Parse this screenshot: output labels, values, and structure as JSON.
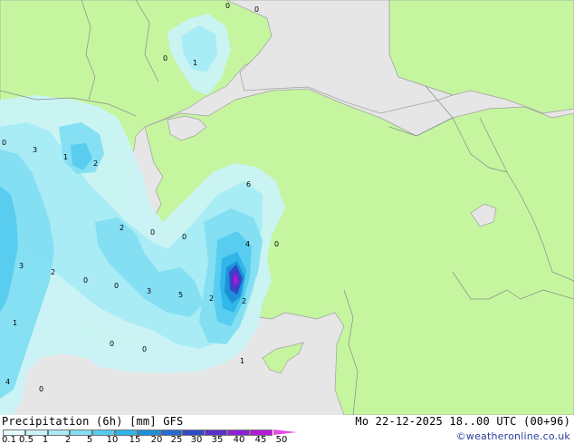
{
  "map": {
    "values": [
      "0",
      "0",
      "1",
      "0",
      "0",
      "3",
      "1",
      "2",
      "6",
      "0",
      "2",
      "0",
      "0",
      "4",
      "3",
      "2",
      "0",
      "0",
      "3",
      "5",
      "2",
      "2",
      "1",
      "0",
      "0",
      "1",
      "4",
      "0"
    ]
  },
  "footer": {
    "title_left": "Precipitation (6h) [mm] GFS",
    "title_right": "Mo 22-12-2025 18..00 UTC (00+96)",
    "credit": "©weatheronline.co.uk"
  },
  "legend": {
    "labels": [
      "0.1",
      "0.5",
      "1",
      "2",
      "5",
      "10",
      "15",
      "20",
      "25",
      "30",
      "35",
      "40",
      "45",
      "50"
    ],
    "colors": [
      "#e6fbfb",
      "#c9f3f7",
      "#a7ebf5",
      "#82def2",
      "#56cbee",
      "#2eb4e8",
      "#1d8fd8",
      "#2669d3",
      "#2f49c7",
      "#5a2fd0",
      "#8d1fd5",
      "#b418d8",
      "#d82adf",
      "#e64be6"
    ],
    "map_colors": {
      "sea": "#e6e6e6",
      "land": "#c6f5a0",
      "border": "#8a8a8a",
      "coast": "#a0a0a0"
    }
  }
}
